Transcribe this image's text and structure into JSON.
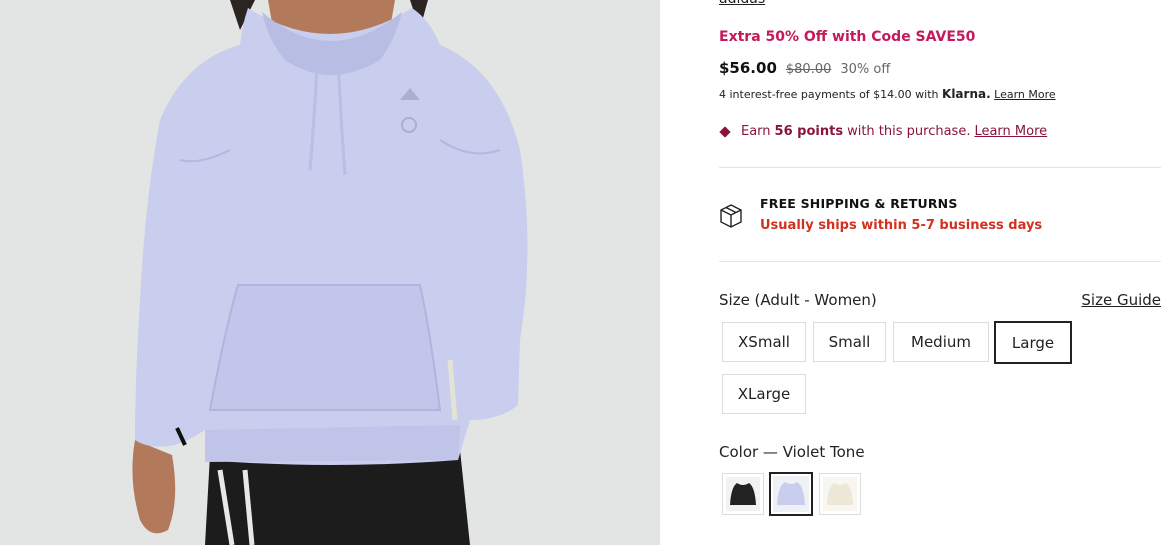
{
  "product": {
    "image_alt": "Violet Tone hoodie front view",
    "brand": "adidas",
    "promo": "Extra 50% Off with Code SAVE50",
    "price_now": "$56.00",
    "price_was": "$80.00",
    "price_off": "30% off",
    "klarna": {
      "prefix": "4 interest-free payments of $14.00 with",
      "logo": "Klarna.",
      "link": "Learn More"
    },
    "points": {
      "prefix": "Earn",
      "amount": "56 points",
      "suffix": "with this purchase.",
      "link": "Learn More"
    },
    "shipping": {
      "title": "FREE SHIPPING & RETURNS",
      "subtitle": "Usually ships within 5-7 business days"
    },
    "size": {
      "label": "Size (Adult - Women)",
      "guide": "Size Guide",
      "options": [
        "XSmall",
        "Small",
        "Medium",
        "Large",
        "XLarge"
      ],
      "selected": "Large"
    },
    "color": {
      "label": "Color — Violet Tone",
      "swatches": [
        "black-swatch",
        "violet-tone-swatch",
        "cream-swatch"
      ],
      "selected": "violet-tone-swatch"
    }
  },
  "colors": {
    "promo": "#c41a5a",
    "points": "#8a1538",
    "shipping_alert": "#d2311f",
    "hoodie": "#c9cdee"
  }
}
